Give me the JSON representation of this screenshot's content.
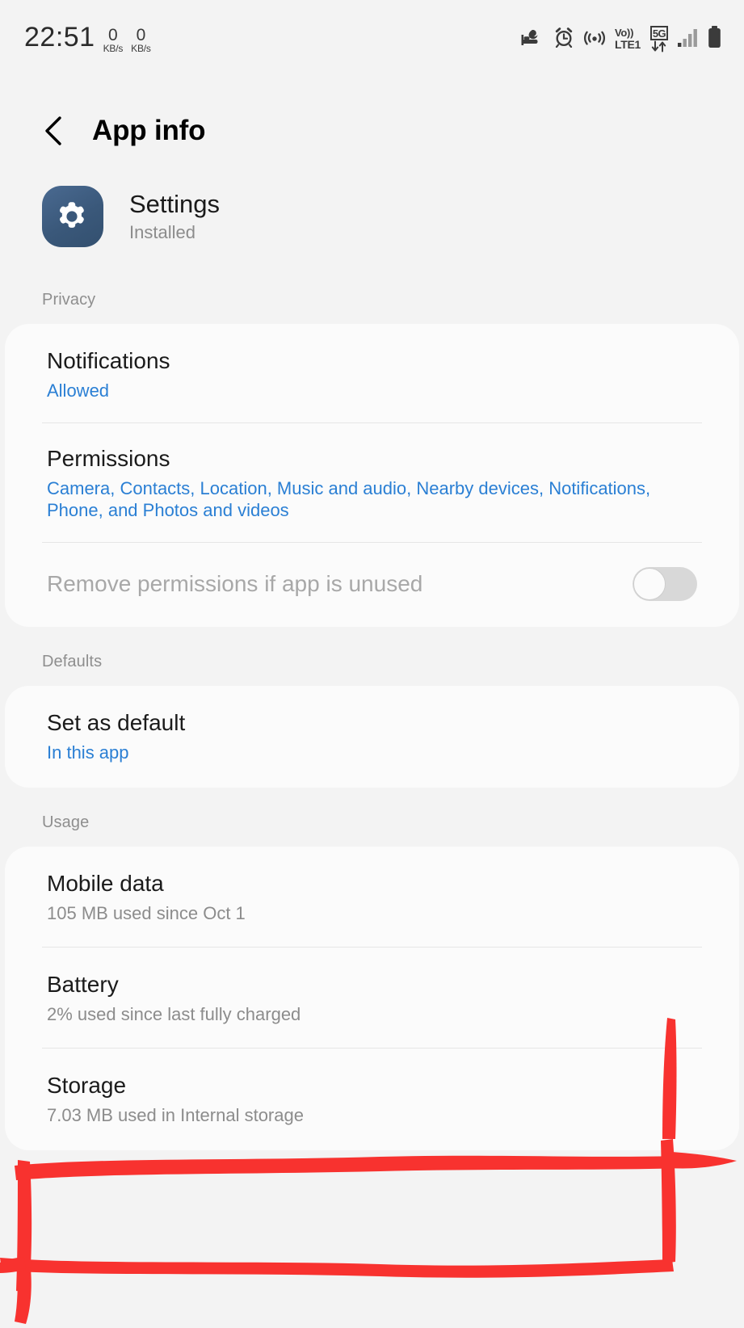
{
  "status_bar": {
    "time": "22:51",
    "net_speed_up": {
      "value": "0",
      "unit": "KB/s"
    },
    "net_speed_down": {
      "value": "0",
      "unit": "KB/s"
    },
    "icons": [
      "sleep-mode-icon",
      "alarm-clock-icon",
      "hotspot-icon",
      "volte-icon",
      "5g-data-icon",
      "signal-bars-icon",
      "battery-icon"
    ],
    "volte_top": "Vo))",
    "volte_bottom": "LTE1",
    "network_type": "5G"
  },
  "header": {
    "back_label": "Back",
    "title": "App info"
  },
  "app": {
    "name": "Settings",
    "install_status": "Installed",
    "icon_color": "#3a587a"
  },
  "colors": {
    "page_background": "#f3f3f3",
    "card_background": "#fbfbfb",
    "link": "#2a7fd4",
    "secondary_text": "#8c8c8c",
    "annotation": "#f8322f"
  },
  "sections": [
    {
      "label": "Privacy",
      "rows": [
        {
          "title": "Notifications",
          "subtitle": "Allowed",
          "subtitle_style": "link",
          "has_toggle": false,
          "disabled": false
        },
        {
          "title": "Permissions",
          "subtitle": "Camera, Contacts, Location, Music and audio, Nearby devices, Notifications, Phone, and Photos and videos",
          "subtitle_style": "link",
          "has_toggle": false,
          "disabled": false
        },
        {
          "title": "Remove permissions if app is unused",
          "subtitle": "",
          "subtitle_style": "none",
          "has_toggle": true,
          "toggle_state": "off",
          "disabled": true
        }
      ]
    },
    {
      "label": "Defaults",
      "rows": [
        {
          "title": "Set as default",
          "subtitle": "In this app",
          "subtitle_style": "link",
          "has_toggle": false,
          "disabled": false
        }
      ]
    },
    {
      "label": "Usage",
      "rows": [
        {
          "title": "Mobile data",
          "subtitle": "105 MB used since Oct 1",
          "subtitle_style": "muted",
          "has_toggle": false,
          "disabled": false
        },
        {
          "title": "Battery",
          "subtitle": "2% used since last fully charged",
          "subtitle_style": "muted",
          "has_toggle": false,
          "disabled": false
        },
        {
          "title": "Storage",
          "subtitle": "7.03 MB used in Internal storage",
          "subtitle_style": "muted",
          "has_toggle": false,
          "disabled": false,
          "annotated": true
        }
      ]
    }
  ],
  "annotation": {
    "shape": "hand-drawn-rectangle",
    "target": "Storage",
    "color": "#f8322f"
  }
}
